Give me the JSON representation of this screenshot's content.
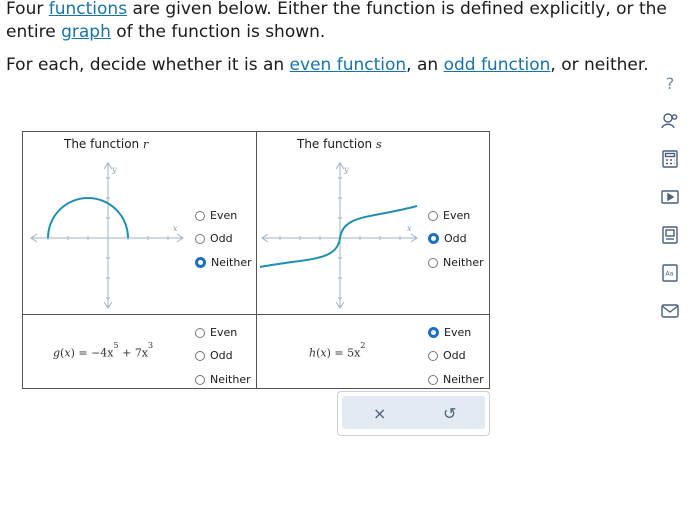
{
  "prompt": {
    "line1_a": "Four ",
    "line1_link1": "functions",
    "line1_b": " are given below. Either the function is defined explicitly, or the entire ",
    "line1_link2": "graph",
    "line1_c": " of the function is shown.",
    "line2_a": "For each, decide whether it is an ",
    "line2_link1": "even function",
    "line2_b": ", an ",
    "line2_link2": "odd function",
    "line2_c": ", or neither."
  },
  "cells": {
    "r": {
      "title_prefix": "The function ",
      "name": "r",
      "axis_x": "x",
      "axis_y": "y",
      "options": [
        "Even",
        "Odd",
        "Neither"
      ],
      "selected": "Neither"
    },
    "s": {
      "title_prefix": "The function ",
      "name": "s",
      "axis_x": "x",
      "axis_y": "y",
      "options": [
        "Even",
        "Odd",
        "Neither"
      ],
      "selected": "Odd"
    },
    "g": {
      "f": "g",
      "x": "x",
      "eq": "=",
      "c1": "−4x",
      "e1": "5",
      "op": "+",
      "c2": "7x",
      "e2": "3",
      "options": [
        "Even",
        "Odd",
        "Neither"
      ],
      "selected": null
    },
    "h": {
      "f": "h",
      "x": "x",
      "eq": "=",
      "c1": "5x",
      "e1": "2",
      "options": [
        "Even",
        "Odd",
        "Neither"
      ],
      "selected": "Even"
    }
  },
  "actions": {
    "clear": "×",
    "reset": "↺"
  },
  "tools": {
    "help": "?",
    "icons": [
      "help-icon",
      "hint-person-icon",
      "calculator-icon",
      "video-icon",
      "textbook-icon",
      "glossary-icon",
      "email-icon"
    ]
  },
  "colors": {
    "accent": "#1b6fc4",
    "curve": "#1f8fb0",
    "link": "#1a73a8"
  }
}
